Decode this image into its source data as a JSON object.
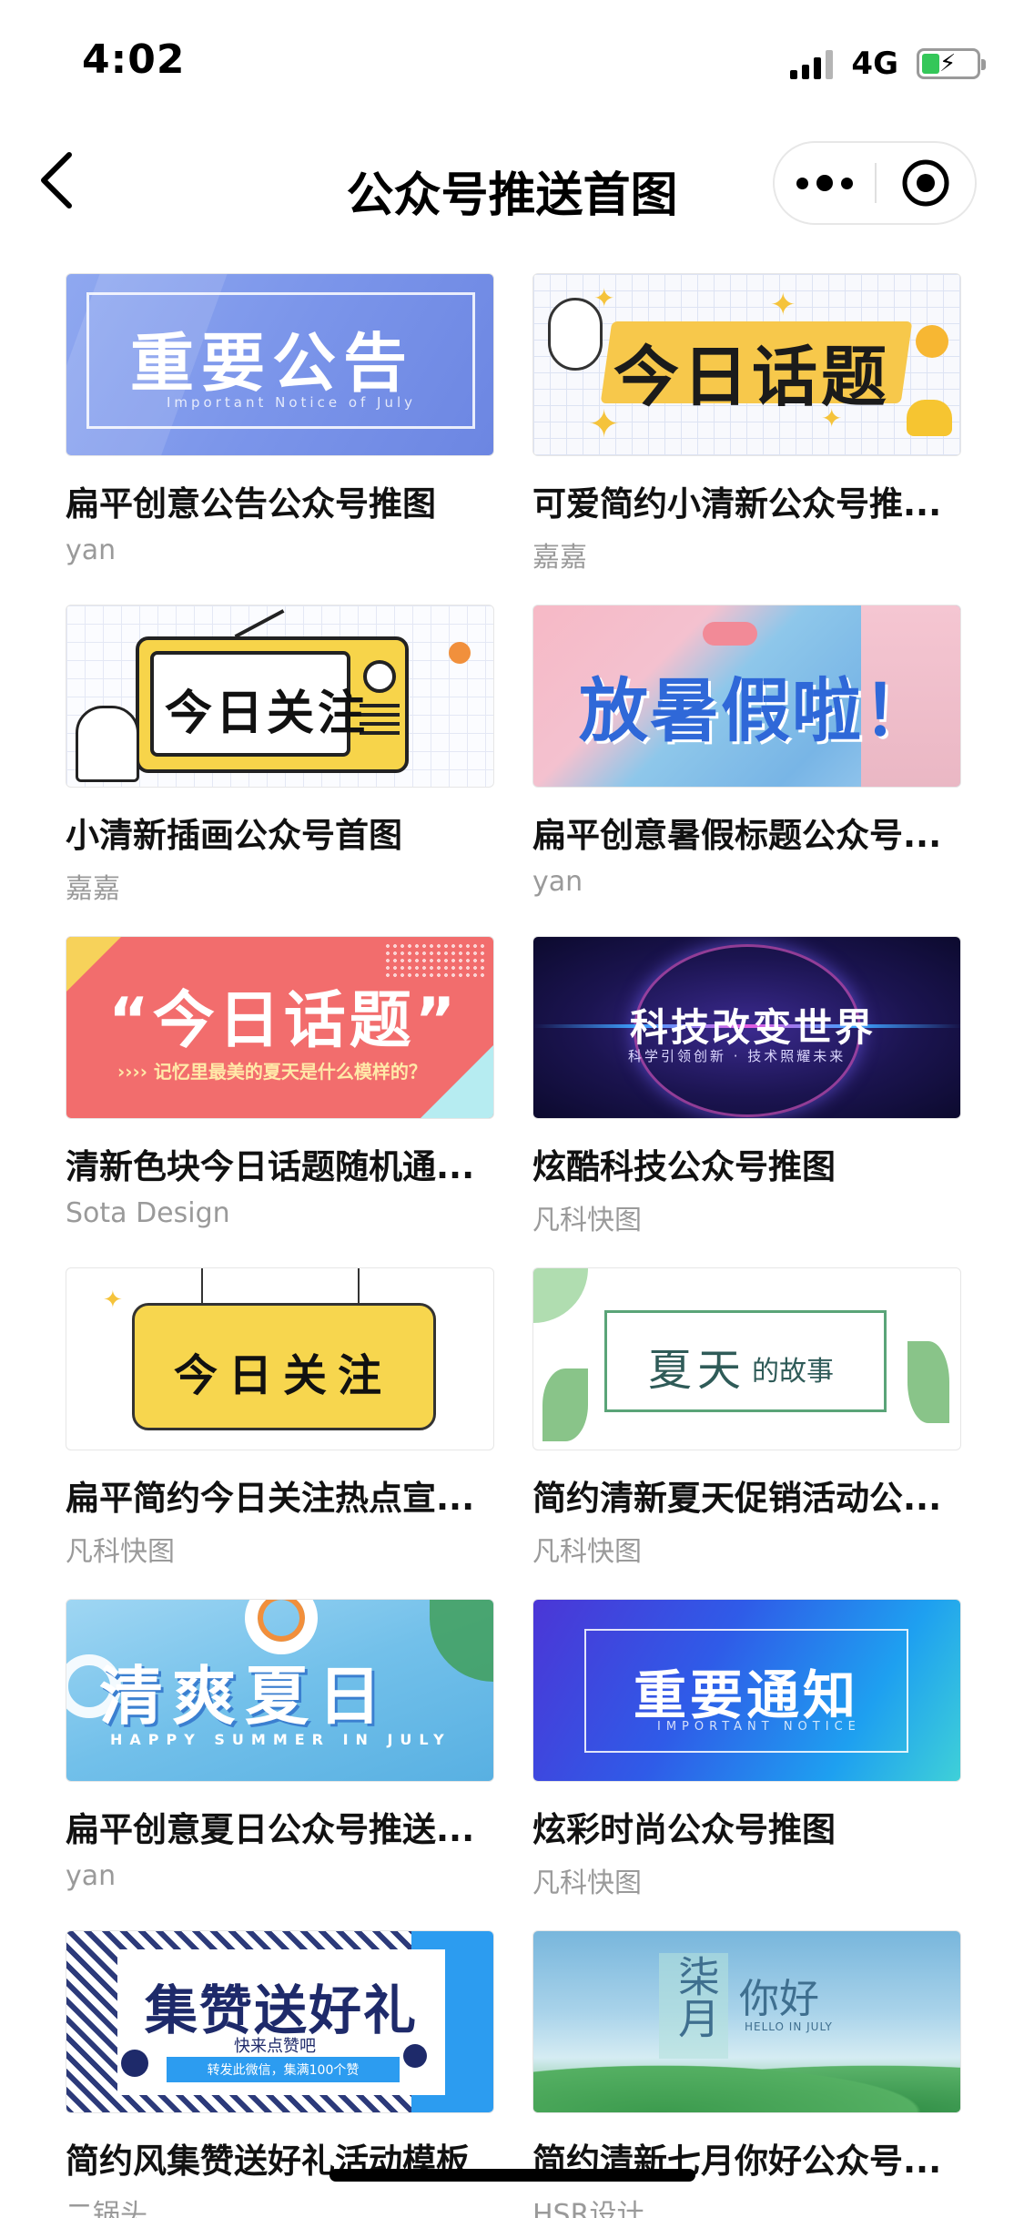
{
  "status": {
    "time": "4:02",
    "network": "4G"
  },
  "nav": {
    "title": "公众号推送首图"
  },
  "cards": [
    {
      "title": "扁平创意公告公众号推图",
      "author": "yan",
      "art": "重要公告",
      "art_sub": "Important Notice of July"
    },
    {
      "title": "可爱简约小清新公众号推...",
      "author": "嘉嘉",
      "art": "今日话题"
    },
    {
      "title": "小清新插画公众号首图",
      "author": "嘉嘉",
      "art": "今日关注"
    },
    {
      "title": "扁平创意暑假标题公众号...",
      "author": "yan",
      "art": "放暑假啦！"
    },
    {
      "title": "清新色块今日话题随机通...",
      "author": "Sota Design",
      "art": "“今日话题”",
      "art_sub": "›››› 记忆里最美的夏天是什么模样的？"
    },
    {
      "title": "炫酷科技公众号推图",
      "author": "凡科快图",
      "art": "科技改变世界",
      "art_sub": "科学引领创新 · 技术照耀未来"
    },
    {
      "title": "扁平简约今日关注热点宣...",
      "author": "凡科快图",
      "art": "今日关注"
    },
    {
      "title": "简约清新夏天促销活动公...",
      "author": "凡科快图",
      "art": "夏天",
      "art_sub": "的故事"
    },
    {
      "title": "扁平创意夏日公众号推送...",
      "author": "yan",
      "art": "清爽夏日",
      "art_sub": "HAPPY SUMMER IN JULY"
    },
    {
      "title": "炫彩时尚公众号推图",
      "author": "凡科快图",
      "art": "重要通知",
      "art_sub": "IMPORTANT NOTICE"
    },
    {
      "title": "简约风集赞送好礼活动模板",
      "author": "二锅头",
      "art": "集赞送好礼",
      "art_sub": "快来点赞吧",
      "art_sub2": "转发此微信，集满100个赞"
    },
    {
      "title": "简约清新七月你好公众号...",
      "author": "HSR设计",
      "art": "柒月",
      "art_sub": "你好",
      "art_sub2": "HELLO IN JULY"
    }
  ],
  "colors": {
    "accent": "#000000",
    "author": "#9a9a9a",
    "battery": "#34c759"
  }
}
